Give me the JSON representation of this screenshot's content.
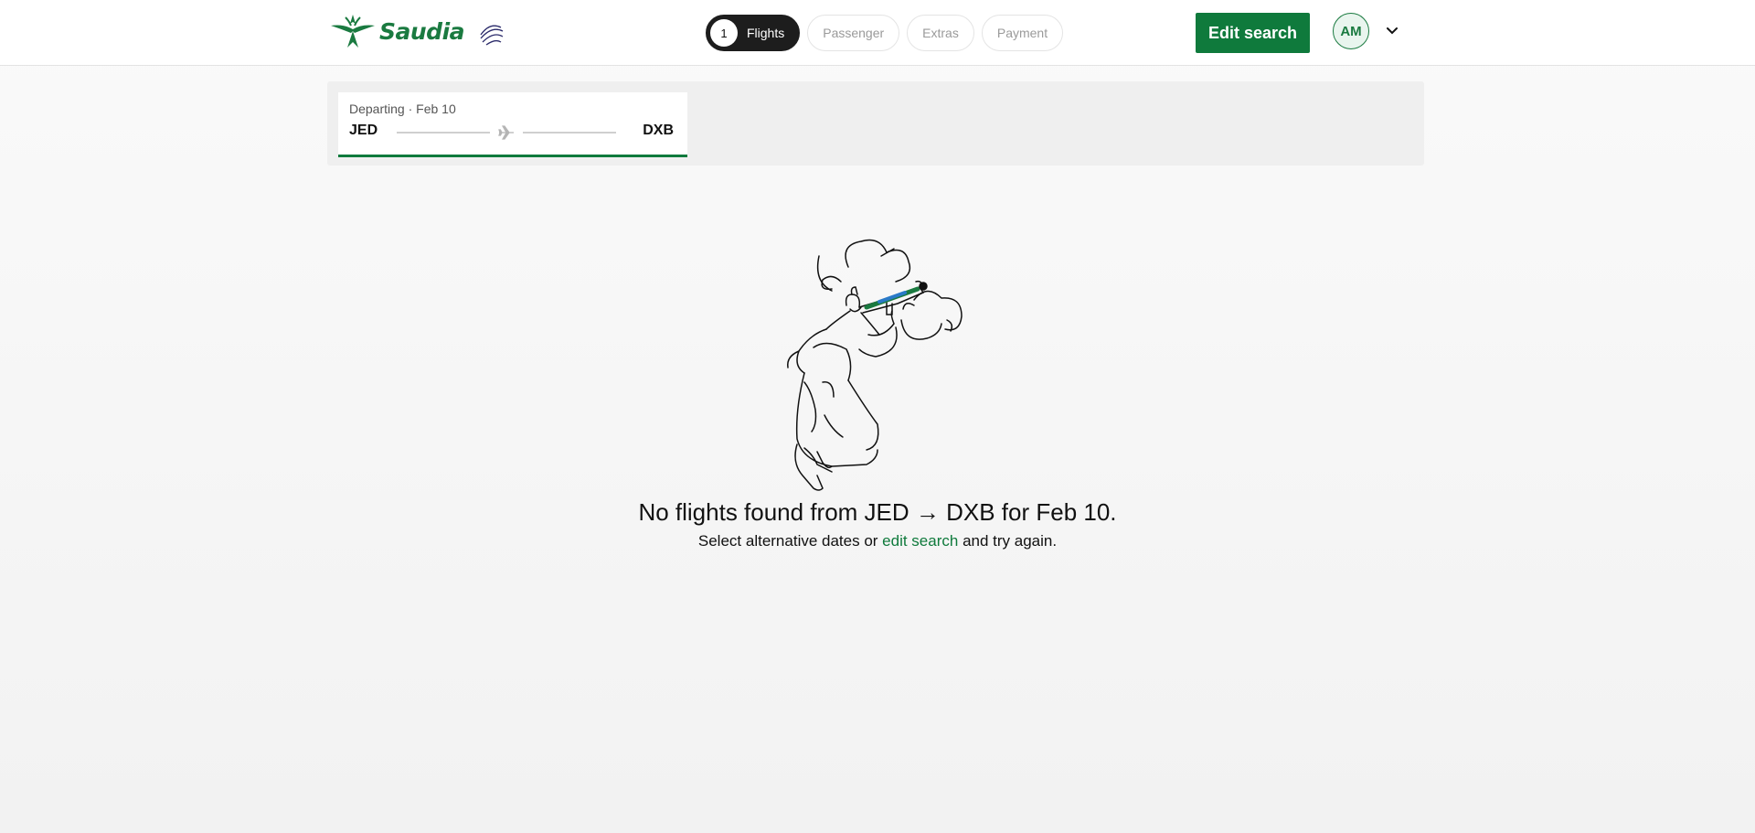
{
  "brand": {
    "name": "Saudia",
    "alliance": "SKYTEAM",
    "brand_color": "#0f7a3c"
  },
  "steps": [
    {
      "number": "1",
      "label": "Flights",
      "active": true
    },
    {
      "label": "Passenger",
      "active": false
    },
    {
      "label": "Extras",
      "active": false
    },
    {
      "label": "Payment",
      "active": false
    }
  ],
  "header": {
    "edit_search_label": "Edit search",
    "avatar_initials": "AM"
  },
  "route": {
    "label": "Departing · Feb 10",
    "from": "JED",
    "to": "DXB"
  },
  "empty_state": {
    "headline": "No flights found from JED → DXB for Feb 10.",
    "sub_before": "Select alternative dates or ",
    "sub_link": "edit search",
    "sub_after": " and try again."
  },
  "icons": [
    "saudia-emblem-icon",
    "skyteam-icon",
    "chevron-down-icon",
    "plane-icon"
  ]
}
